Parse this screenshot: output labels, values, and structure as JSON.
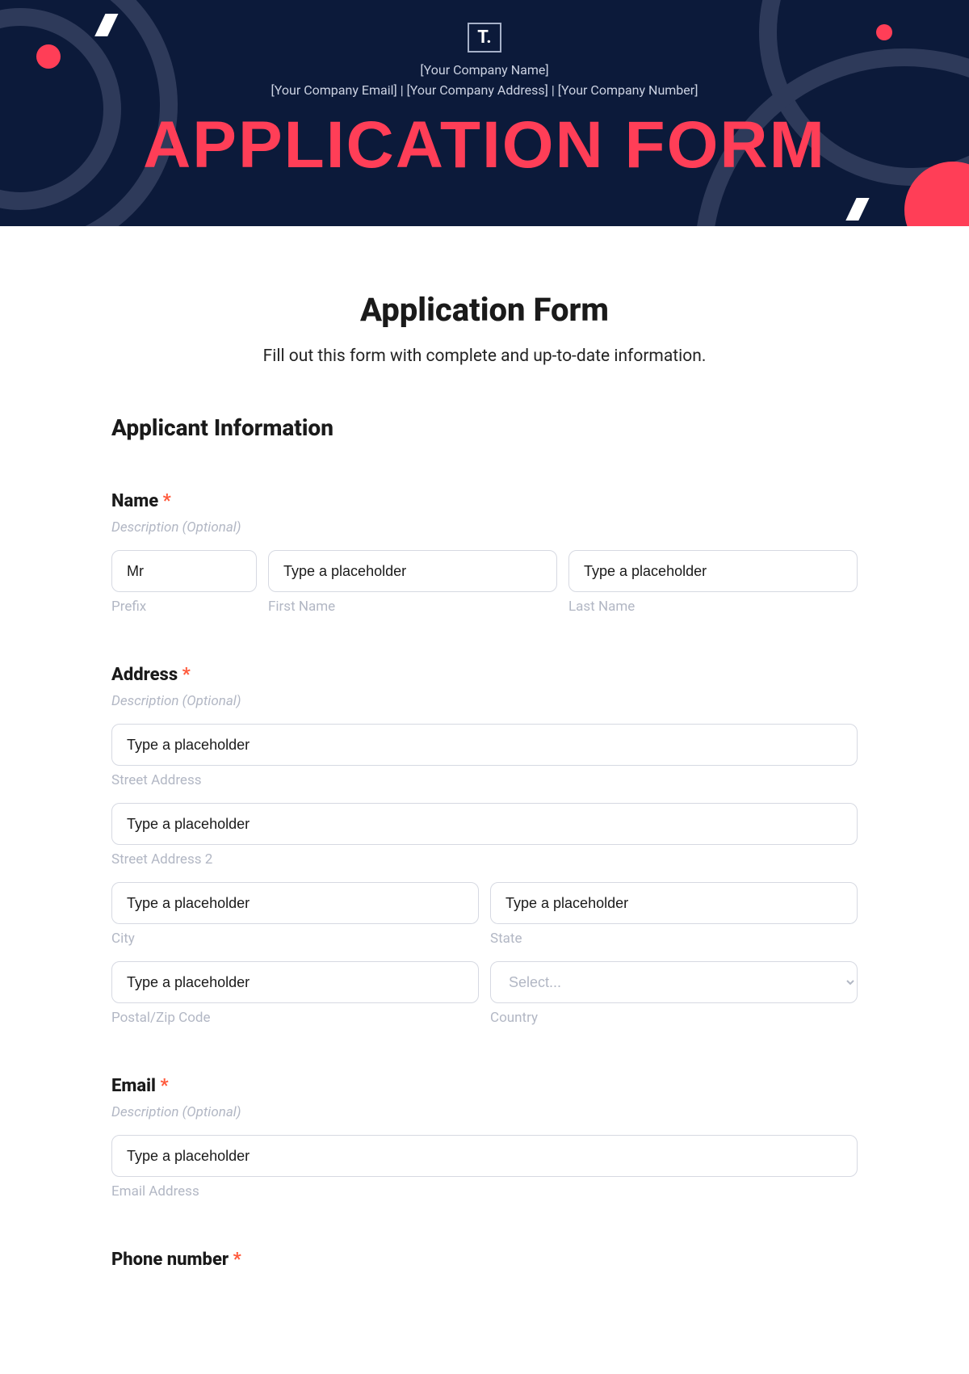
{
  "header": {
    "logo_text": "T.",
    "company_name": "[Your Company Name]",
    "company_email": "[Your Company Email]",
    "company_address": "[Your Company Address]",
    "company_number": "[Your Company Number]",
    "separator": "  |  ",
    "hero_title": "APPLICATION FORM"
  },
  "form": {
    "title": "Application Form",
    "subtitle": "Fill out this form with complete and up-to-date information.",
    "section_applicant": "Applicant Information",
    "desc_optional": "Description (Optional)",
    "name": {
      "label": "Name",
      "prefix_value": "Mr",
      "prefix_sublabel": "Prefix",
      "first_placeholder": "Type a placeholder",
      "first_sublabel": "First Name",
      "last_placeholder": "Type a placeholder",
      "last_sublabel": "Last Name"
    },
    "address": {
      "label": "Address",
      "street_placeholder": "Type a placeholder",
      "street_sublabel": "Street Address",
      "street2_placeholder": "Type a placeholder",
      "street2_sublabel": "Street Address 2",
      "city_placeholder": "Type a placeholder",
      "city_sublabel": "City",
      "state_placeholder": "Type a placeholder",
      "state_sublabel": "State",
      "postal_placeholder": "Type a placeholder",
      "postal_sublabel": "Postal/Zip Code",
      "country_placeholder": "Select...",
      "country_sublabel": "Country"
    },
    "email": {
      "label": "Email",
      "placeholder": "Type a placeholder",
      "sublabel": "Email Address"
    },
    "phone": {
      "label": "Phone number"
    }
  }
}
